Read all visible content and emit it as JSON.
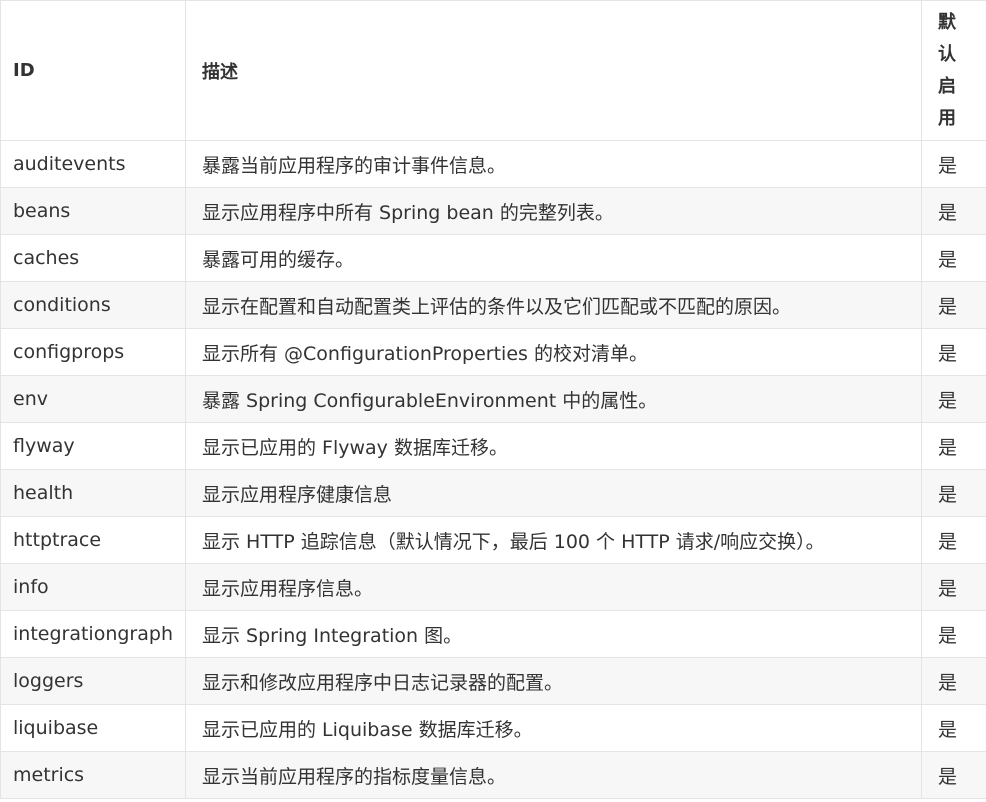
{
  "table": {
    "headers": {
      "id": "ID",
      "description": "描述",
      "enabled_by_default": "默认启用"
    },
    "rows": [
      {
        "id": "auditevents",
        "description": "暴露当前应用程序的审计事件信息。",
        "enabled": "是"
      },
      {
        "id": "beans",
        "description": "显示应用程序中所有 Spring bean 的完整列表。",
        "enabled": "是"
      },
      {
        "id": "caches",
        "description": "暴露可用的缓存。",
        "enabled": "是"
      },
      {
        "id": "conditions",
        "description": "显示在配置和自动配置类上评估的条件以及它们匹配或不匹配的原因。",
        "enabled": "是"
      },
      {
        "id": "configprops",
        "description": "显示所有 @ConfigurationProperties 的校对清单。",
        "enabled": "是"
      },
      {
        "id": "env",
        "description": "暴露 Spring ConfigurableEnvironment 中的属性。",
        "enabled": "是"
      },
      {
        "id": "flyway",
        "description": "显示已应用的 Flyway 数据库迁移。",
        "enabled": "是"
      },
      {
        "id": "health",
        "description": "显示应用程序健康信息",
        "enabled": "是"
      },
      {
        "id": "httptrace",
        "description": "显示 HTTP 追踪信息（默认情况下，最后 100 个  HTTP 请求/响应交换）。",
        "enabled": "是"
      },
      {
        "id": "info",
        "description": "显示应用程序信息。",
        "enabled": "是"
      },
      {
        "id": "integrationgraph",
        "description": "显示 Spring Integration 图。",
        "enabled": "是"
      },
      {
        "id": "loggers",
        "description": "显示和修改应用程序中日志记录器的配置。",
        "enabled": "是"
      },
      {
        "id": "liquibase",
        "description": "显示已应用的 Liquibase 数据库迁移。",
        "enabled": "是"
      },
      {
        "id": "metrics",
        "description": "显示当前应用程序的指标度量信息。",
        "enabled": "是"
      }
    ]
  }
}
